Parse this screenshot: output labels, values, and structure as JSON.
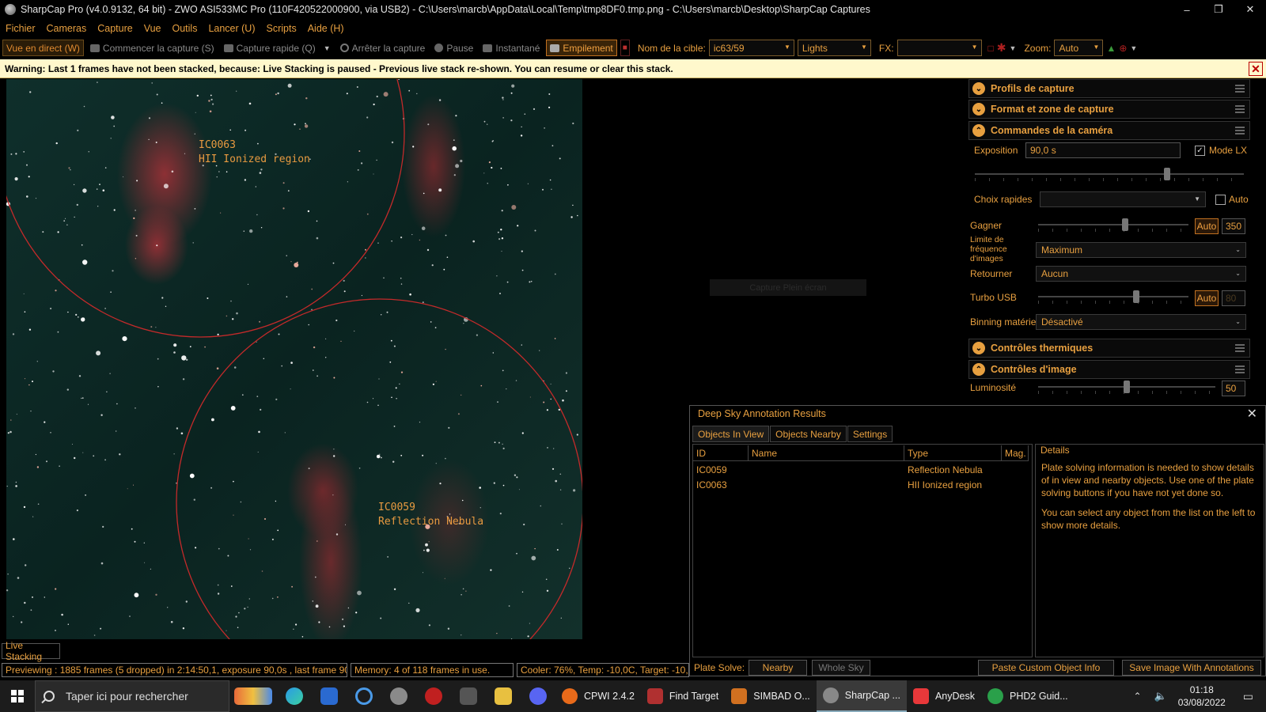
{
  "window": {
    "title": "SharpCap Pro (v4.0.9132, 64 bit) - ZWO ASI533MC Pro (110F420522000900, via USB2) - C:\\Users\\marcb\\AppData\\Local\\Temp\\tmp8DF0.tmp.png - C:\\Users\\marcb\\Desktop\\SharpCap Captures",
    "minimize": "–",
    "restore": "❐",
    "close": "✕"
  },
  "menu": [
    "Fichier",
    "Cameras",
    "Capture",
    "Vue",
    "Outils",
    "Lancer (U)",
    "Scripts",
    "Aide (H)"
  ],
  "toolbar": {
    "live_view": "Vue en direct (W)",
    "start_capture": "Commencer la capture (S)",
    "quick_capture": "Capture rapide (Q)",
    "stop_capture": "Arrêter la capture",
    "pause": "Pause",
    "snapshot": "Instantané",
    "stacking": "Empilement",
    "target_label": "Nom de la cible:",
    "target_value": "ic63/59",
    "frame_type": "Lights",
    "fx_label": "FX:",
    "fx_value": "",
    "zoom_label": "Zoom:",
    "zoom_value": "Auto"
  },
  "warning": {
    "text": "Warning: Last 1 frames have not been stacked, because: Live Stacking is paused - Previous live stack re-shown. You can resume or clear this stack.",
    "close": "✕"
  },
  "annotations": [
    {
      "id": "IC0063",
      "type": "HII Ionized region"
    },
    {
      "id": "IC0059",
      "type": "Reflection Nebula"
    }
  ],
  "overlay_button": "Capture Plein écran",
  "right_panel": {
    "sections": {
      "capture_profiles": "Profils de capture",
      "format": "Format et zone de capture",
      "camera_controls": "Commandes de la caméra",
      "thermal": "Contrôles thermiques",
      "image_controls": "Contrôles d'image"
    },
    "exposure_label": "Exposition",
    "exposure_value": "90,0 s",
    "lx_mode": "Mode LX",
    "quick_choice_label": "Choix rapides",
    "auto_label": "Auto",
    "gain_label": "Gagner",
    "gain_auto": "Auto",
    "gain_value": "350",
    "frame_rate_label": "Limite de fréquence d'images",
    "frame_rate_value": "Maximum",
    "flip_label": "Retourner",
    "flip_value": "Aucun",
    "turbo_label": "Turbo USB",
    "turbo_auto": "Auto",
    "turbo_value": "80",
    "binning_label": "Binning matériel",
    "binning_value": "Désactivé",
    "brightness_label": "Luminosité",
    "brightness_value": "50",
    "exposure_slider_level": 0.72,
    "gain_slider_level": 0.58,
    "turbo_slider_level": 0.66,
    "brightness_slider_level": 0.5
  },
  "dsa": {
    "title": "Deep Sky Annotation Results",
    "close": "✕",
    "tabs": [
      "Objects In View",
      "Objects Nearby",
      "Settings"
    ],
    "columns": [
      "ID",
      "Name",
      "Type",
      "Mag."
    ],
    "rows": [
      {
        "id": "IC0059",
        "name": "",
        "type": "Reflection Nebula",
        "mag": ""
      },
      {
        "id": "IC0063",
        "name": "",
        "type": "HII Ionized region",
        "mag": ""
      }
    ],
    "details_header": "Details",
    "details_p1": "Plate solving information is needed to show details of in view and nearby objects. Use one of the plate solving buttons if you have not yet done so.",
    "details_p2": "You can select any object from the list on the left to show more details.",
    "plate_solve_label": "Plate Solve:",
    "nearby": "Nearby",
    "whole_sky": "Whole Sky",
    "paste_custom": "Paste Custom Object Info",
    "save_image": "Save Image With Annotations"
  },
  "status": {
    "live_stacking": "Live Stacking",
    "previewing": "Previewing : 1885 frames (5 dropped) in 2:14:50,1, exposure 90,0s , last frame 90,5",
    "memory": "Memory: 4 of 118 frames in use.",
    "cooler": "Cooler: 76%, Temp: -10,0C, Target: -10,0C"
  },
  "taskbar": {
    "search_placeholder": "Taper ici pour rechercher",
    "apps": [
      "CPWI 2.4.2",
      "Find Target",
      "SIMBAD O...",
      "SharpCap ...",
      "AnyDesk",
      "PHD2 Guid..."
    ],
    "time": "01:18",
    "date": "03/08/2022"
  }
}
